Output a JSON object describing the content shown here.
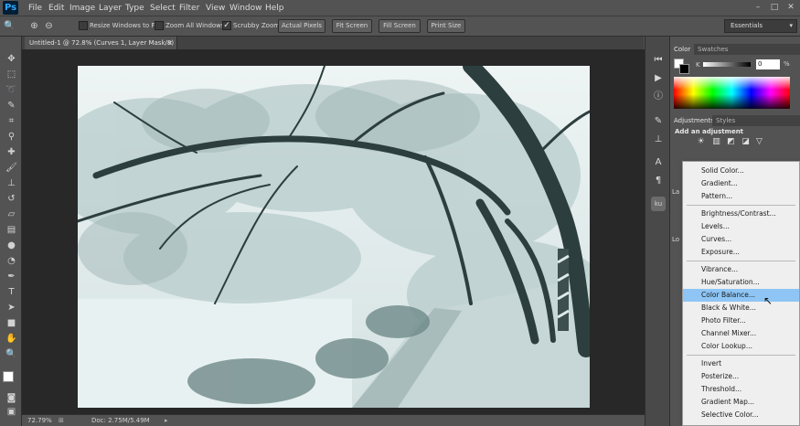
{
  "app": {
    "logo": "Ps"
  },
  "menu": [
    "File",
    "Edit",
    "Image",
    "Layer",
    "Type",
    "Select",
    "Filter",
    "View",
    "Window",
    "Help"
  ],
  "window_controls": [
    "–",
    "□",
    "✕"
  ],
  "options_bar": {
    "resize_windows": "Resize Windows to Fit",
    "zoom_all": "Zoom All Windows",
    "scrubby_zoom": "Scrubby Zoom",
    "scrubby_checked": true,
    "buttons": [
      "Actual Pixels",
      "Fit Screen",
      "Fill Screen",
      "Print Size"
    ],
    "workspace": "Essentials"
  },
  "document": {
    "tab_title": "Untitled-1 @ 72.8% (Curves 1, Layer Mask/8) *",
    "tab_close": "×"
  },
  "status": {
    "zoom": "72.79%",
    "doc": "Doc: 2.75M/5.49M"
  },
  "panels": {
    "color_tabs": [
      "Color",
      "Swatches"
    ],
    "k_label": "K",
    "k_value": "0",
    "k_unit": "%",
    "adjust_tabs": [
      "Adjustments",
      "Styles"
    ],
    "add_adjustment": "Add an adjustment",
    "layers_prefix": "La",
    "lock_prefix": "Lo"
  },
  "dropdown": {
    "groups": [
      [
        "Solid Color...",
        "Gradient...",
        "Pattern..."
      ],
      [
        "Brightness/Contrast...",
        "Levels...",
        "Curves...",
        "Exposure..."
      ],
      [
        "Vibrance...",
        "Hue/Saturation...",
        "Color Balance...",
        "Black & White...",
        "Photo Filter...",
        "Channel Mixer...",
        "Color Lookup..."
      ],
      [
        "Invert",
        "Posterize...",
        "Threshold...",
        "Gradient Map...",
        "Selective Color..."
      ]
    ],
    "selected": "Color Balance..."
  },
  "colors": {
    "bg": "#535353",
    "canvas_bg": "#282828",
    "highlight": "#8ec5f4"
  }
}
